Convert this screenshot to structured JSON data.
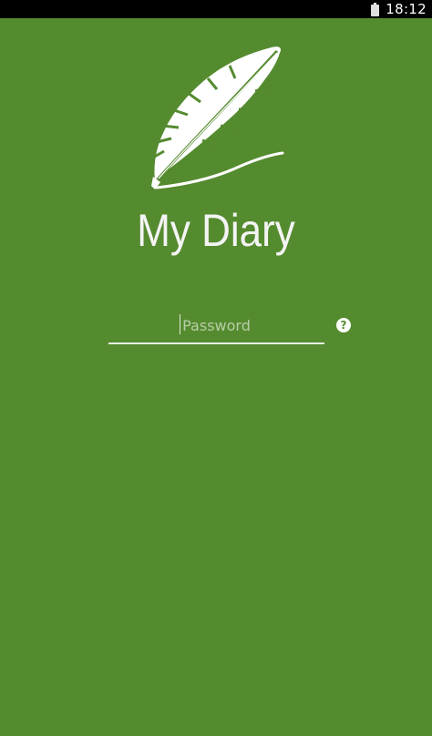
{
  "status_bar": {
    "time": "18:12",
    "battery_icon": "battery-icon"
  },
  "app": {
    "title": "My Diary",
    "logo_icon": "feather-pen-icon",
    "background_color": "#558b2f"
  },
  "login": {
    "password_placeholder": "Password",
    "password_value": "",
    "help_glyph": "?",
    "help_icon": "help-icon"
  }
}
